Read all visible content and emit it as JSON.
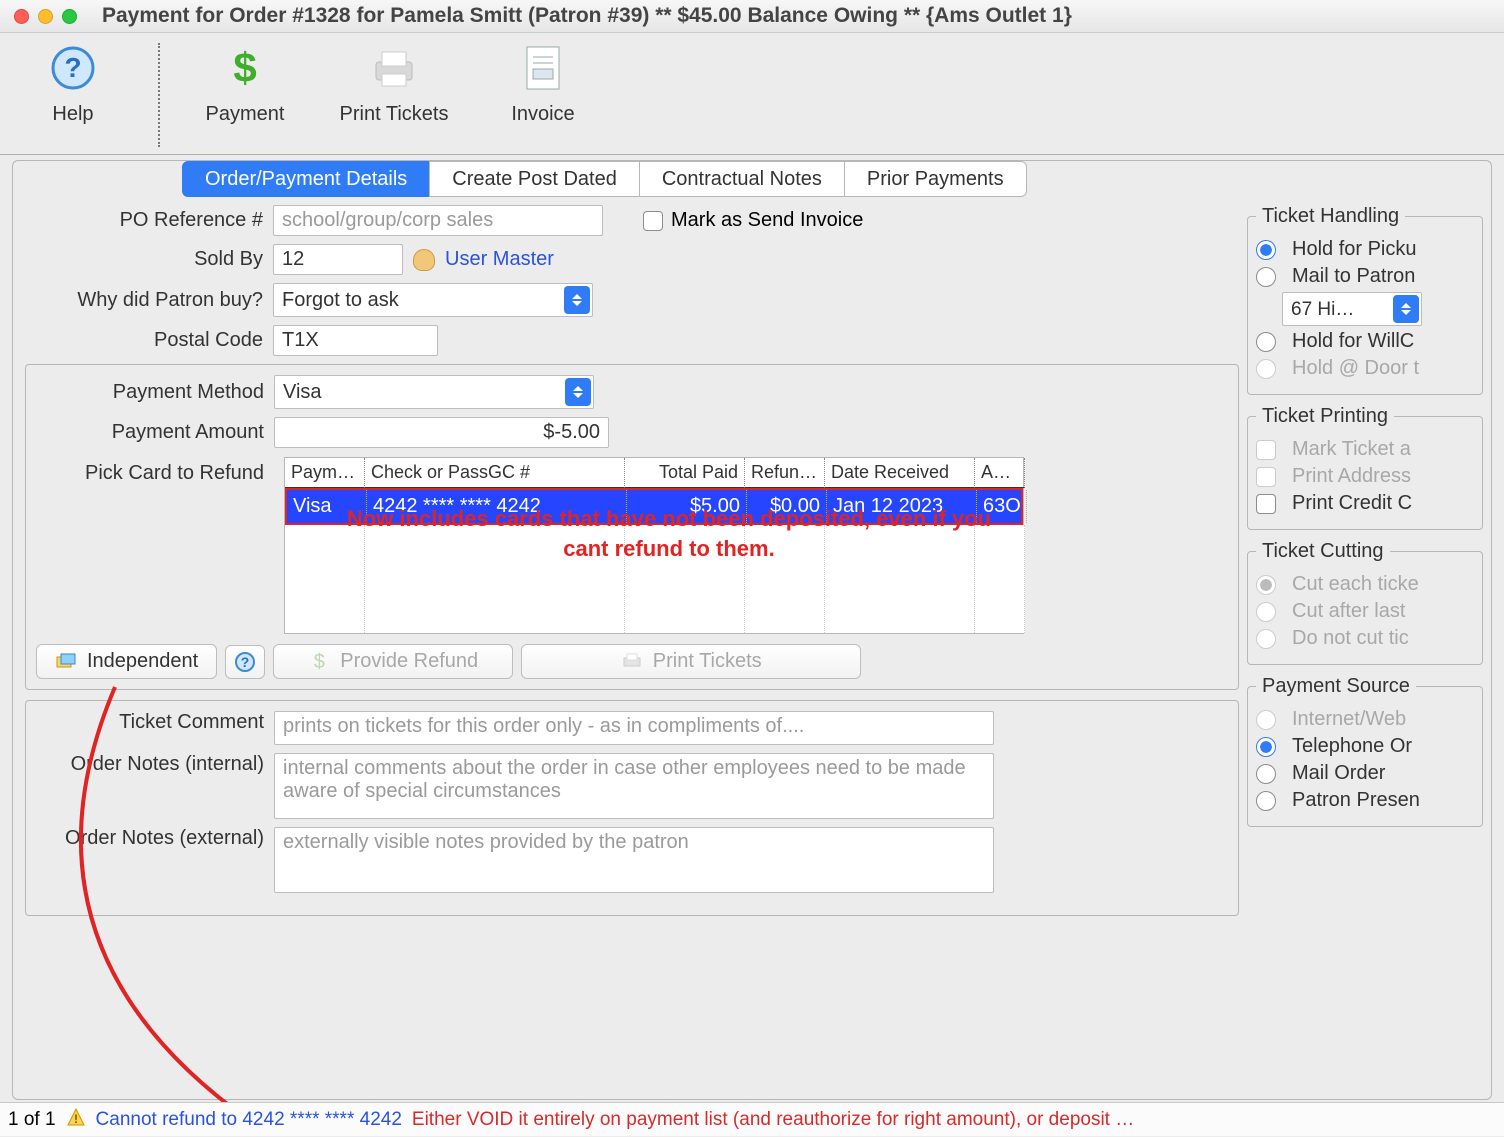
{
  "window": {
    "title": "Payment for Order #1328 for Pamela Smitt (Patron #39) ** $45.00 Balance Owing ** {Ams Outlet 1}"
  },
  "toolbar": {
    "help": "Help",
    "payment": "Payment",
    "print_tickets": "Print Tickets",
    "invoice": "Invoice"
  },
  "tabs": {
    "order_payment": "Order/Payment Details",
    "create_post_dated": "Create Post Dated",
    "contractual_notes": "Contractual Notes",
    "prior_payments": "Prior Payments"
  },
  "form": {
    "po_ref_label": "PO Reference #",
    "po_ref_placeholder": "school/group/corp sales",
    "mark_send_invoice": "Mark as Send Invoice",
    "sold_by_label": "Sold By",
    "sold_by_value": "12",
    "user_master": "User Master",
    "why_buy_label": "Why did Patron buy?",
    "why_buy_value": "Forgot to ask",
    "postal_label": "Postal Code",
    "postal_value": "T1X",
    "pay_method_label": "Payment Method",
    "pay_method_value": "Visa",
    "pay_amount_label": "Payment Amount",
    "pay_amount_value": "$-5.00",
    "pick_card_label": "Pick Card to Refund",
    "card_table": {
      "headers": {
        "c1": "Paymen…",
        "c2": "Check or PassGC #",
        "c3": "Total Paid",
        "c4": "Refund…",
        "c5": "Date Received",
        "c6": "Auth"
      },
      "row": {
        "c1": "Visa",
        "c2": "4242 **** **** 4242",
        "c3": "$5.00",
        "c4": "$0.00",
        "c5": "Jan 12 2023",
        "c6": "63O"
      }
    },
    "annotation": "Now includes cards that have not been deposited, even if you cant refund to them.",
    "independent": "Independent",
    "provide_refund": "Provide Refund",
    "print_tickets_btn": "Print Tickets",
    "ticket_comment_label": "Ticket Comment",
    "ticket_comment_ph": "prints on tickets for this order only - as in compliments of....",
    "order_notes_int_label": "Order Notes (internal)",
    "order_notes_int_ph": "internal comments about the order in case other employees need to be made aware of special circumstances",
    "order_notes_ext_label": "Order Notes (external)",
    "order_notes_ext_ph": "externally visible notes provided by the patron"
  },
  "side": {
    "ticket_handling": {
      "legend": "Ticket Handling",
      "hold_pickup": "Hold for Picku",
      "mail_patron": "Mail to Patron",
      "address_sel": "67 Hi…",
      "hold_willcall": "Hold for WillC",
      "hold_door": "Hold @ Door t"
    },
    "ticket_printing": {
      "legend": "Ticket Printing",
      "mark_ticket": "Mark Ticket a",
      "print_address": "Print Address",
      "print_credit": "Print Credit C"
    },
    "ticket_cutting": {
      "legend": "Ticket Cutting",
      "cut_each": "Cut each ticke",
      "cut_after": "Cut after last",
      "do_not_cut": "Do not cut tic"
    },
    "payment_source": {
      "legend": "Payment Source",
      "internet": "Internet/Web",
      "telephone": "Telephone Or",
      "mail": "Mail Order",
      "patron": "Patron Presen"
    }
  },
  "status": {
    "count": "1 of 1",
    "link": "Cannot refund to 4242 **** **** 4242",
    "msg": "Either VOID it entirely on payment list (and reauthorize for right amount), or deposit …"
  }
}
